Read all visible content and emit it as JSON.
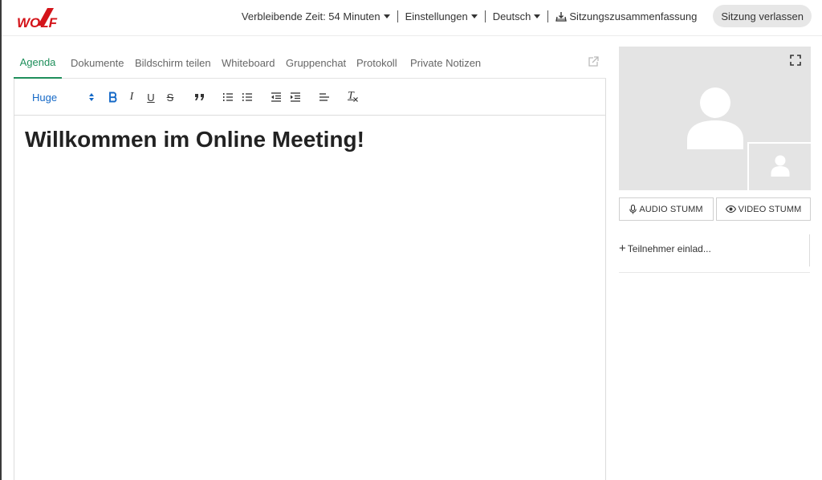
{
  "brand": {
    "logo_text": "WOLF",
    "color": "#d4141a"
  },
  "topbar": {
    "time_remaining": "Verbleibende Zeit: 54 Minuten",
    "settings": "Einstellungen",
    "language": "Deutsch",
    "summary": "Sitzungszusammenfassung",
    "leave": "Sitzung verlassen"
  },
  "tabs": [
    "Agenda",
    "Dokumente",
    "Bildschirm teilen",
    "Whiteboard",
    "Gruppenchat",
    "Protokoll",
    "Private Notizen"
  ],
  "active_tab": "Agenda",
  "accent_color": "#1f8f5b",
  "toolbar": {
    "font_size": "Huge",
    "italic": "I",
    "underline": "U",
    "strike": "S",
    "clear_format": "T",
    "icons": [
      "bold-icon",
      "italic-icon",
      "underline-icon",
      "strikethrough-icon",
      "blockquote-icon",
      "ordered-list-icon",
      "bullet-list-icon",
      "outdent-icon",
      "indent-icon",
      "align-left-icon",
      "clear-format-icon"
    ]
  },
  "editor": {
    "heading": "Willkommen im Online Meeting!"
  },
  "controls": {
    "audio": "AUDIO STUMM",
    "video": "VIDEO STUMM"
  },
  "participants": {
    "invite": "Teilnehmer einlad..."
  }
}
